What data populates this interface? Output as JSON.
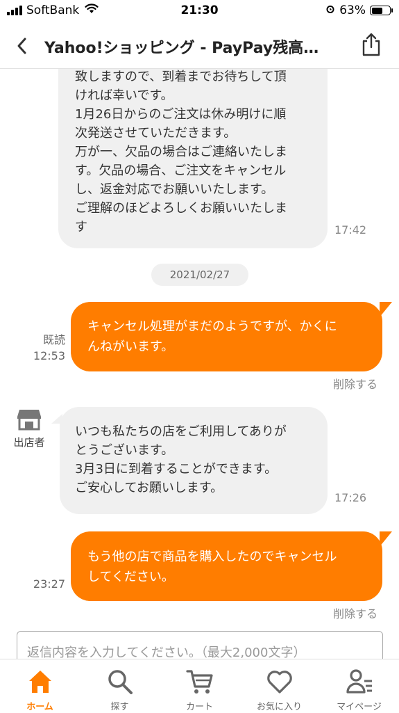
{
  "status_bar": {
    "carrier": "SoftBank",
    "time": "21:30",
    "battery": "63%",
    "battery_level": 0.63
  },
  "header": {
    "title": "Yahoo!ショッピング - PayPay残高…",
    "back_icon": "chevron-left-icon",
    "share_icon": "share-icon"
  },
  "messages": {
    "m1": {
      "text": "致しますので、到着までお待ちして頂\nければ幸いです。\n1月26日からのご注文は休み明けに順\n次発送させていただきます。\n万が一、欠品の場合はご連絡いたしま\nす。欠品の場合、ご注文をキャンセル\nし、返金対応でお願いいたします。\nご理解のほどよろしくお願いいたしま\nす",
      "time": "17:42"
    },
    "date_separator": "2021/02/27",
    "m2": {
      "text": "キャンセル処理がまだのようですが、かくに\nんねがいます。",
      "read": "既読",
      "time": "12:53",
      "delete": "削除する"
    },
    "m3": {
      "sender": "出店者",
      "text": "いつも私たちの店をご利用してありが\nとうございます。\n3月3日に到着することができます。\nご安心してお願いします。",
      "time": "17:26"
    },
    "m4": {
      "text": "もう他の店で商品を購入したのでキャンセル\nしてください。",
      "time": "23:27",
      "delete": "削除する"
    }
  },
  "reply": {
    "placeholder": "返信内容を入力してください。（最大2,000文字）"
  },
  "tabbar": {
    "items": [
      {
        "label": "ホーム",
        "icon": "home-icon",
        "active": true
      },
      {
        "label": "探す",
        "icon": "search-icon",
        "active": false
      },
      {
        "label": "カート",
        "icon": "cart-icon",
        "active": false
      },
      {
        "label": "お気に入り",
        "icon": "heart-icon",
        "active": false
      },
      {
        "label": "マイページ",
        "icon": "user-icon",
        "active": false
      }
    ]
  },
  "colors": {
    "accent": "#ff7d00",
    "bubble_incoming": "#f0f0f0"
  }
}
